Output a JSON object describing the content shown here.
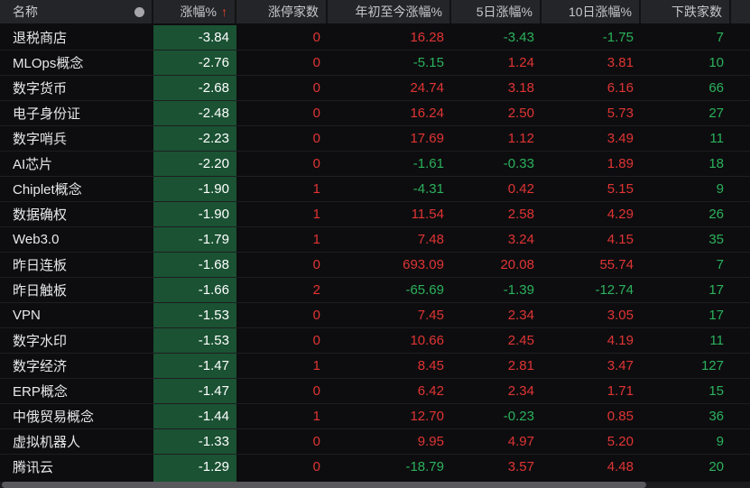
{
  "table": {
    "columns": [
      {
        "key": "name",
        "label": "名称",
        "align": "left"
      },
      {
        "key": "change",
        "label": "涨幅%",
        "align": "right",
        "sorted": "asc"
      },
      {
        "key": "limit_up",
        "label": "涨停家数",
        "align": "right"
      },
      {
        "key": "ytd",
        "label": "年初至今涨幅%",
        "align": "right"
      },
      {
        "key": "d5",
        "label": "5日涨幅%",
        "align": "right"
      },
      {
        "key": "d10",
        "label": "10日涨幅%",
        "align": "right"
      },
      {
        "key": "decliners",
        "label": "下跌家数",
        "align": "right"
      }
    ],
    "sort_icon": "↑",
    "marker_icon": "circle",
    "rows": [
      {
        "name": "退税商店",
        "change": "-3.84",
        "limit_up": "0",
        "ytd": "16.28",
        "d5": "-3.43",
        "d10": "-1.75",
        "decliners": "7"
      },
      {
        "name": "MLOps概念",
        "change": "-2.76",
        "limit_up": "0",
        "ytd": "-5.15",
        "d5": "1.24",
        "d10": "3.81",
        "decliners": "10"
      },
      {
        "name": "数字货币",
        "change": "-2.68",
        "limit_up": "0",
        "ytd": "24.74",
        "d5": "3.18",
        "d10": "6.16",
        "decliners": "66"
      },
      {
        "name": "电子身份证",
        "change": "-2.48",
        "limit_up": "0",
        "ytd": "16.24",
        "d5": "2.50",
        "d10": "5.73",
        "decliners": "27"
      },
      {
        "name": "数字哨兵",
        "change": "-2.23",
        "limit_up": "0",
        "ytd": "17.69",
        "d5": "1.12",
        "d10": "3.49",
        "decliners": "11"
      },
      {
        "name": "AI芯片",
        "change": "-2.20",
        "limit_up": "0",
        "ytd": "-1.61",
        "d5": "-0.33",
        "d10": "1.89",
        "decliners": "18"
      },
      {
        "name": "Chiplet概念",
        "change": "-1.90",
        "limit_up": "1",
        "ytd": "-4.31",
        "d5": "0.42",
        "d10": "5.15",
        "decliners": "9"
      },
      {
        "name": "数据确权",
        "change": "-1.90",
        "limit_up": "1",
        "ytd": "11.54",
        "d5": "2.58",
        "d10": "4.29",
        "decliners": "26"
      },
      {
        "name": "Web3.0",
        "change": "-1.79",
        "limit_up": "1",
        "ytd": "7.48",
        "d5": "3.24",
        "d10": "4.15",
        "decliners": "35"
      },
      {
        "name": "昨日连板",
        "change": "-1.68",
        "limit_up": "0",
        "ytd": "693.09",
        "d5": "20.08",
        "d10": "55.74",
        "decliners": "7"
      },
      {
        "name": "昨日触板",
        "change": "-1.66",
        "limit_up": "2",
        "ytd": "-65.69",
        "d5": "-1.39",
        "d10": "-12.74",
        "decliners": "17"
      },
      {
        "name": "VPN",
        "change": "-1.53",
        "limit_up": "0",
        "ytd": "7.45",
        "d5": "2.34",
        "d10": "3.05",
        "decliners": "17"
      },
      {
        "name": "数字水印",
        "change": "-1.53",
        "limit_up": "0",
        "ytd": "10.66",
        "d5": "2.45",
        "d10": "4.19",
        "decliners": "11"
      },
      {
        "name": "数字经济",
        "change": "-1.47",
        "limit_up": "1",
        "ytd": "8.45",
        "d5": "2.81",
        "d10": "3.47",
        "decliners": "127"
      },
      {
        "name": "ERP概念",
        "change": "-1.47",
        "limit_up": "0",
        "ytd": "6.42",
        "d5": "2.34",
        "d10": "1.71",
        "decliners": "15"
      },
      {
        "name": "中俄贸易概念",
        "change": "-1.44",
        "limit_up": "1",
        "ytd": "12.70",
        "d5": "-0.23",
        "d10": "0.85",
        "decliners": "36"
      },
      {
        "name": "虚拟机器人",
        "change": "-1.33",
        "limit_up": "0",
        "ytd": "9.95",
        "d5": "4.97",
        "d10": "5.20",
        "decliners": "9"
      },
      {
        "name": "腾讯云",
        "change": "-1.29",
        "limit_up": "0",
        "ytd": "-18.79",
        "d5": "3.57",
        "d10": "4.48",
        "decliners": "20"
      }
    ]
  },
  "colors": {
    "up_red": "#e03434",
    "down_green": "#2bb15c",
    "change_cell_bg": "#1a5233",
    "header_bg": "#242528",
    "header_fg": "#c6c7cb",
    "sort_arrow": "#e8472b"
  }
}
